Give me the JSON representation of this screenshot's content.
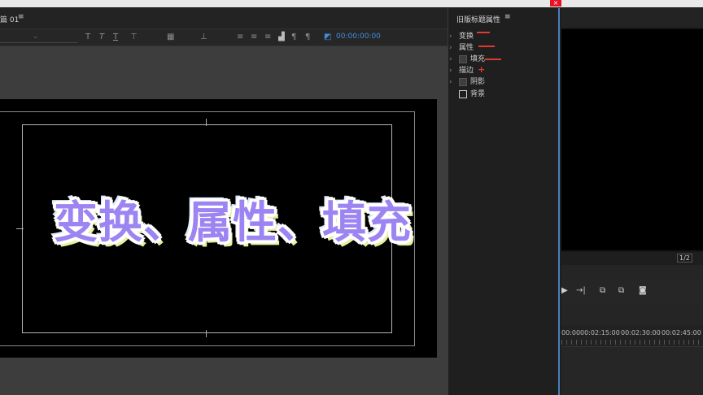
{
  "window": {
    "close_glyph": "×"
  },
  "editor": {
    "title": "篇 01",
    "menu_glyph": "≡",
    "toolbar": {
      "bold": "T",
      "italic": "T",
      "underline": "T",
      "timecode": "00:00:00:00"
    },
    "title_text": "变换、属性、填充"
  },
  "properties_panel": {
    "title": "旧版标题属性",
    "menu_glyph": "≡",
    "items": [
      {
        "label": "变换",
        "has_checkbox": false
      },
      {
        "label": "属性",
        "has_checkbox": false
      },
      {
        "label": "填充",
        "has_checkbox": true
      },
      {
        "label": "描边",
        "has_checkbox": false
      },
      {
        "label": "阴影",
        "has_checkbox": true
      },
      {
        "label": "背景",
        "has_checkbox": true
      }
    ],
    "annotation_plus": "+"
  },
  "program_monitor": {
    "page_indicator": "1/2",
    "transport": {
      "play": "▶",
      "step_forward": "→|"
    }
  },
  "timeline": {
    "ruler_labels": [
      "00:00",
      "00:02:15:00",
      "00:02:30:00",
      "00:02:45:00"
    ]
  },
  "colors": {
    "accent_blue": "#3f8fdb",
    "annotation_red": "#e03a2e",
    "title_fill": "#9c84f2"
  }
}
